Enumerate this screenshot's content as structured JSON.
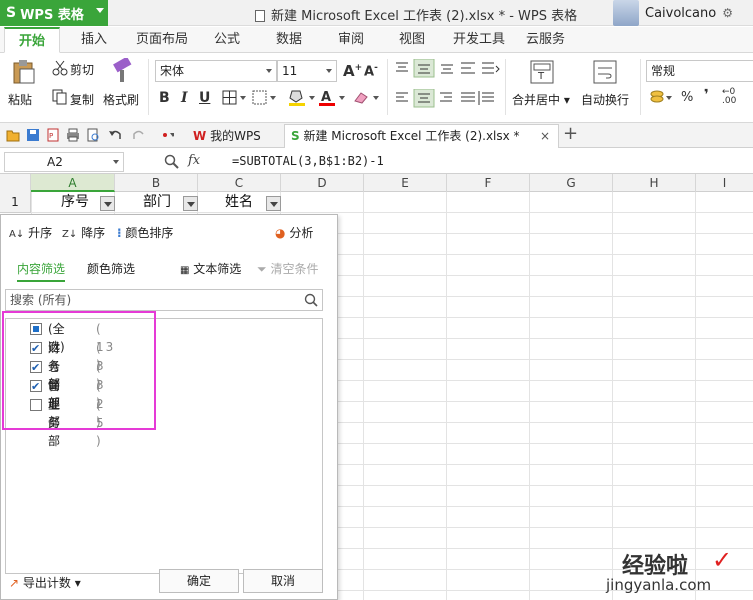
{
  "app": {
    "name": "WPS 表格",
    "logo": "S"
  },
  "title": {
    "text": "新建 Microsoft Excel 工作表 (2).xlsx * - WPS 表格"
  },
  "user": {
    "name": "Caivolcano"
  },
  "tabs": [
    "开始",
    "插入",
    "页面布局",
    "公式",
    "数据",
    "审阅",
    "视图",
    "开发工具",
    "云服务"
  ],
  "ribbon": {
    "paste": "粘贴",
    "cut": "剪切",
    "copy": "复制",
    "format_painter": "格式刷",
    "font_name": "宋体",
    "font_size": "11",
    "merge_center": "合并居中",
    "auto_wrap": "自动换行",
    "number_format": "常规",
    "percent": "%",
    "comma": "❜"
  },
  "doc_tabs": {
    "my_wps": "我的WPS",
    "file": "新建 Microsoft Excel 工作表 (2).xlsx *"
  },
  "formula_bar": {
    "cell_ref": "A2",
    "fx": "fx",
    "formula": "=SUBTOTAL(3,B$1:B2)-1"
  },
  "sheet": {
    "columns": [
      "A",
      "B",
      "C",
      "D",
      "E",
      "F",
      "G",
      "H",
      "I"
    ],
    "row1": "1",
    "headers": [
      "序号",
      "部门",
      "姓名"
    ]
  },
  "filter_panel": {
    "sort_asc": "升序",
    "sort_desc": "降序",
    "color_sort": "颜色排序",
    "analyze": "分析",
    "tab_content": "内容筛选",
    "tab_color": "颜色筛选",
    "text_filter": "文本筛选",
    "clear": "清空条件",
    "search_placeholder": "搜索 (所有)",
    "items": [
      {
        "label": "(全选)",
        "count": "( 13 )",
        "state": "partial"
      },
      {
        "label": "财务部",
        "count": "( 3 )",
        "state": "checked"
      },
      {
        "label": "仓储部",
        "count": "( 3 )",
        "state": "checked"
      },
      {
        "label": "管理部",
        "count": "( 2 )",
        "state": "checked"
      },
      {
        "label": "业务部",
        "count": "( 5 )",
        "state": "unchecked"
      }
    ],
    "export": "导出计数",
    "ok": "确定",
    "cancel": "取消"
  },
  "watermark": {
    "line1": "经验啦",
    "line2": "jingyanla.com",
    "mark": "✓"
  },
  "colors": {
    "accent": "#3aa53a",
    "highlight": "#e53ad6"
  }
}
